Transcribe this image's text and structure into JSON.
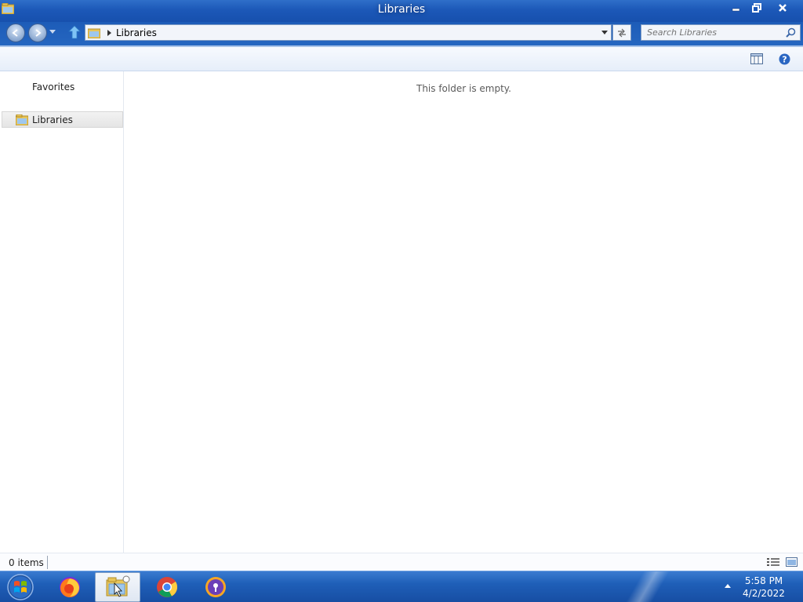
{
  "window": {
    "title": "Libraries",
    "icon": "libraries-folder-icon"
  },
  "caption_buttons": [
    "minimize-icon",
    "restore-icon",
    "close-icon"
  ],
  "address": {
    "crumb": "Libraries",
    "search_placeholder": "Search Libraries"
  },
  "nav_pane": {
    "favorites_label": "Favorites",
    "libraries_label": "Libraries"
  },
  "content": {
    "empty_message": "This folder is empty."
  },
  "status": {
    "item_count": "0 items"
  },
  "taskbar": {
    "apps": [
      "firefox-icon",
      "explorer-icon",
      "chrome-icon",
      "vpn-shield-icon"
    ],
    "clock_time": "5:58 PM",
    "clock_date": "4/2/2022"
  },
  "colors": {
    "title_bar": "#1c58b8",
    "taskbar": "#1f5fb8",
    "selection": "#e5e5e5"
  }
}
